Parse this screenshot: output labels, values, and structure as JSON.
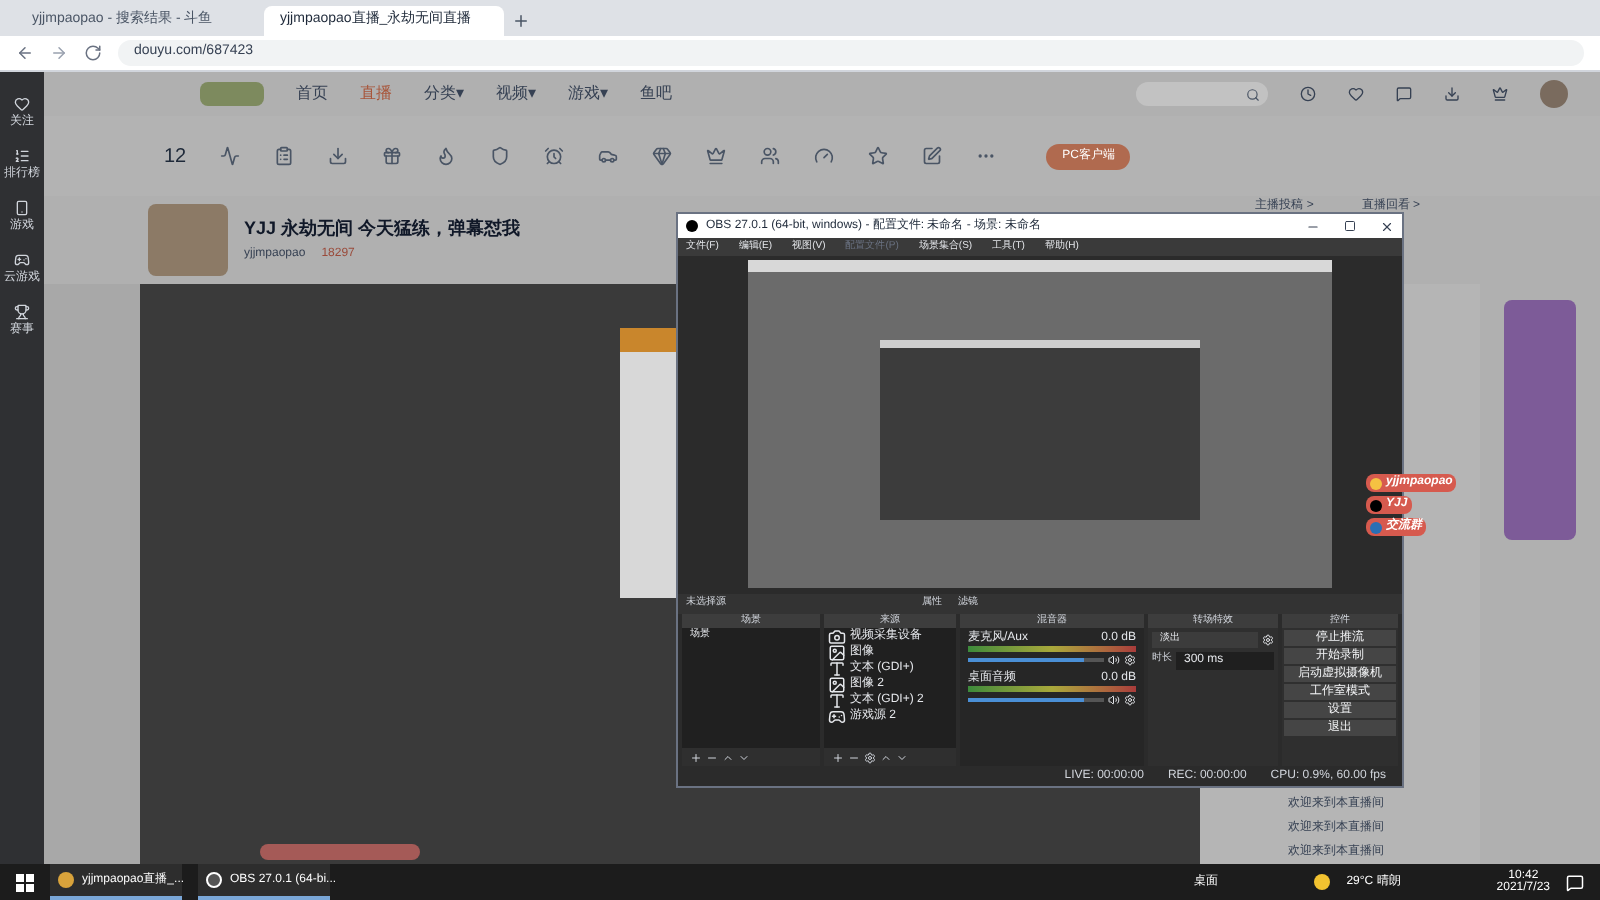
{
  "browser": {
    "tabs": [
      {
        "label": "yjjmpaopao - 搜索结果 - 斗鱼",
        "selected": false
      },
      {
        "label": "yjjmpaopao直播_永劫无间直播",
        "selected": true
      }
    ],
    "url": "douyu.com/687423"
  },
  "site": {
    "nav": [
      {
        "label": "首页",
        "selected": false
      },
      {
        "label": "直播",
        "selected": true
      },
      {
        "label": "分类▾",
        "selected": false
      },
      {
        "label": "视频▾",
        "selected": false
      },
      {
        "label": "游戏▾",
        "selected": false
      },
      {
        "label": "鱼吧",
        "selected": false
      }
    ],
    "sidebar": [
      "关注",
      "排行榜",
      "游戏",
      "云游戏",
      "赛事"
    ],
    "score": "12",
    "pc_button": "PC客户端",
    "stream": {
      "title": "YJJ 永劫无间 今天猛练，弹幕怼我",
      "host": "yjjmpaopao",
      "heat": "18297"
    },
    "side_links": [
      "主播投稿 >",
      "直播回看 >"
    ],
    "chat": [
      {
        "text": "欢迎来到本直播间"
      },
      {
        "text": "欢迎来到本直播间"
      },
      {
        "text": "欢迎来到本直播间"
      }
    ]
  },
  "overlay_labels": [
    {
      "kind": "weibo",
      "text": "yjjmpaopao"
    },
    {
      "kind": "douyin",
      "text": "YJJ"
    },
    {
      "kind": "qq",
      "text": "交流群"
    }
  ],
  "obs": {
    "title": "OBS 27.0.1 (64-bit, windows) - 配置文件: 未命名 - 场景: 未命名",
    "menu": [
      {
        "label": "文件(F)",
        "disabled": false
      },
      {
        "label": "编辑(E)",
        "disabled": false
      },
      {
        "label": "视图(V)",
        "disabled": false
      },
      {
        "label": "配置文件(P)",
        "disabled": true
      },
      {
        "label": "场景集合(S)",
        "disabled": false
      },
      {
        "label": "工具(T)",
        "disabled": false
      },
      {
        "label": "帮助(H)",
        "disabled": false
      }
    ],
    "no_source": "未选择源",
    "properties": "属性",
    "filters": "滤镜",
    "docks": [
      "场景",
      "来源",
      "混音器",
      "转场特效",
      "控件"
    ],
    "scenes": [
      "场景"
    ],
    "sources": [
      {
        "kind": "camera",
        "name": "视频采集设备"
      },
      {
        "kind": "image",
        "name": "图像"
      },
      {
        "kind": "text",
        "name": "文本 (GDI+)"
      },
      {
        "kind": "image",
        "name": "图像 2"
      },
      {
        "kind": "text",
        "name": "文本 (GDI+) 2"
      },
      {
        "kind": "game",
        "name": "游戏源 2"
      }
    ],
    "mixer": [
      {
        "name": "麦克风/Aux",
        "reading": "0.0 dB",
        "level": 0.85
      },
      {
        "name": "桌面音频",
        "reading": "0.0 dB",
        "level": 0.85
      }
    ],
    "transition": {
      "value": "淡出",
      "duration_label": "时长",
      "duration": "300 ms"
    },
    "controls": [
      "停止推流",
      "开始录制",
      "启动虚拟摄像机",
      "工作室模式",
      "设置",
      "退出"
    ],
    "status": {
      "live": "LIVE: 00:00:00",
      "rec": "REC: 00:00:00",
      "cpu": "CPU: 0.9%, 60.00 fps"
    }
  },
  "taskbar": {
    "apps": [
      {
        "label": "yjjmpaopao直播_...",
        "kind": "chrome"
      },
      {
        "label": "OBS 27.0.1 (64-bi...",
        "kind": "obs"
      }
    ],
    "desktop": "桌面",
    "weather": "29°C 晴朗",
    "time": "10:42",
    "date": "2021/7/23"
  }
}
